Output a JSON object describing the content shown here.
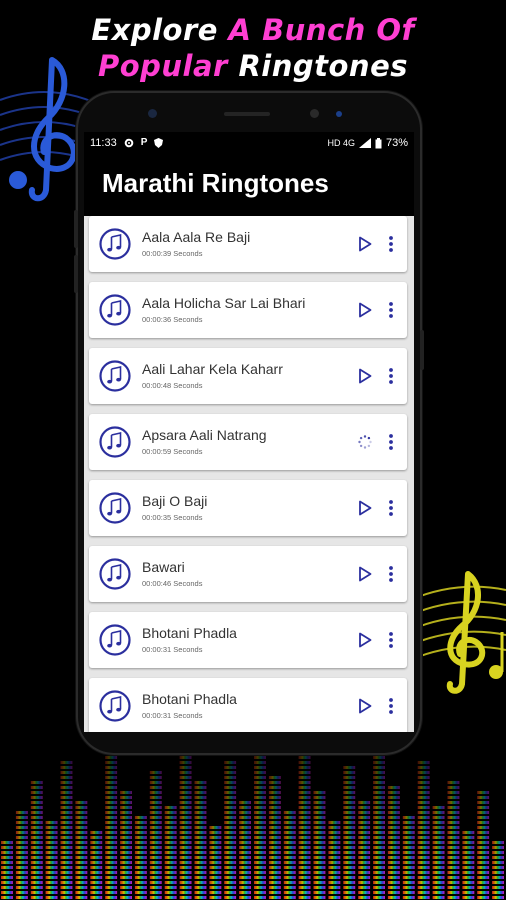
{
  "promo": {
    "line1_white": "Explore ",
    "line1_pink": "A Bunch Of",
    "line2_pink": "Popular ",
    "line2_white": "Ringtones"
  },
  "status_bar": {
    "time": "11:33",
    "left_icons": [
      "gear-icon",
      "parking-icon",
      "shield-icon"
    ],
    "network": "HD 4G",
    "battery": "73%"
  },
  "app": {
    "title": "Marathi Ringtones"
  },
  "ringtones": [
    {
      "title": "Aala Aala Re Baji",
      "duration": "00:00:39 Seconds",
      "state": "play"
    },
    {
      "title": "Aala Holicha Sar Lai Bhari",
      "duration": "00:00:36 Seconds",
      "state": "play"
    },
    {
      "title": "Aali Lahar Kela Kaharr",
      "duration": "00:00:48 Seconds",
      "state": "play"
    },
    {
      "title": "Apsara Aali Natrang",
      "duration": "00:00:59 Seconds",
      "state": "loading"
    },
    {
      "title": "Baji O Baji",
      "duration": "00:00:35 Seconds",
      "state": "play"
    },
    {
      "title": "Bawari",
      "duration": "00:00:46 Seconds",
      "state": "play"
    },
    {
      "title": "Bhotani Phadla",
      "duration": "00:00:31 Seconds",
      "state": "play"
    },
    {
      "title": "Bhotani Phadla",
      "duration": "00:00:31 Seconds",
      "state": "play"
    }
  ],
  "colors": {
    "accent": "#2b2f9e",
    "promo_pink": "#ff3fd2",
    "card_bg": "#ffffff",
    "list_bg": "#e6e6e6",
    "appbar_bg": "#000000"
  }
}
